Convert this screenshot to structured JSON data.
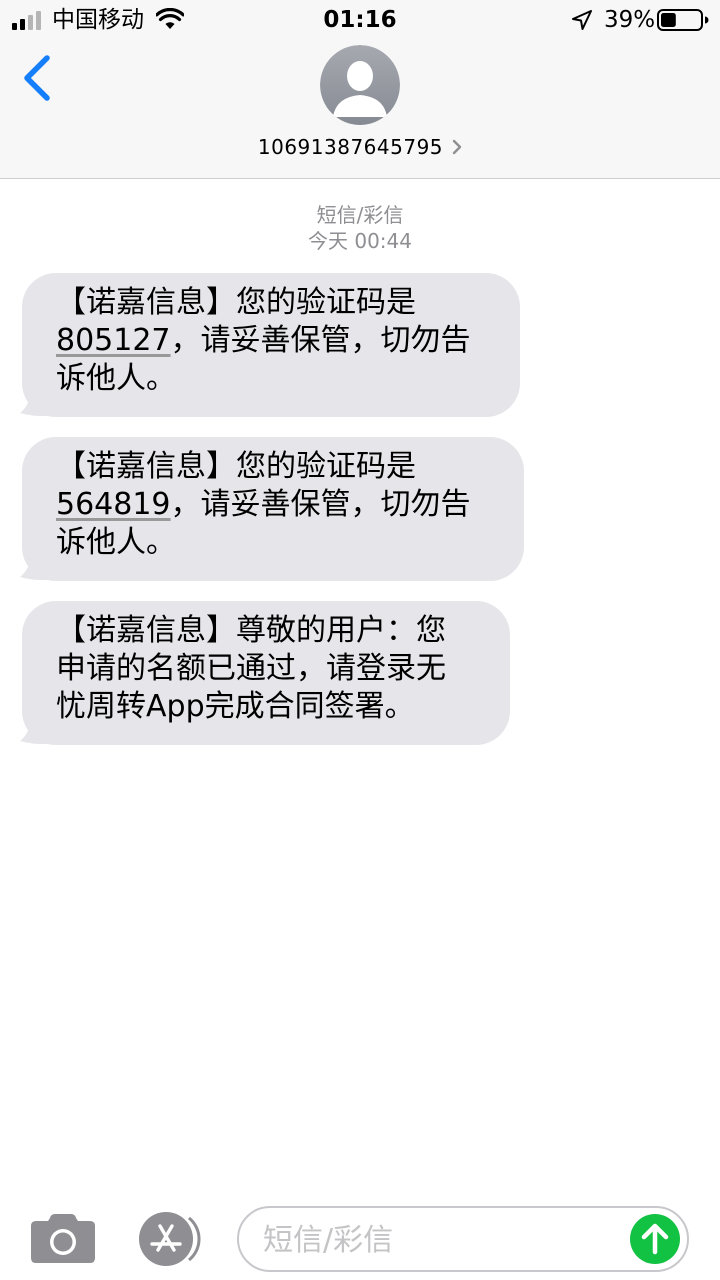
{
  "status_bar": {
    "carrier": "中国移动",
    "time": "01:16",
    "battery_percent": "39%",
    "battery_level": 0.39,
    "icons": [
      "signal-icon",
      "wifi-icon",
      "location-arrow-icon",
      "battery-icon"
    ]
  },
  "header": {
    "back_icon": "chevron-left-icon",
    "avatar_icon": "person-silhouette-icon",
    "contact_number": "10691387645795",
    "contact_chevron_icon": "chevron-right-icon"
  },
  "conversation": {
    "service_label": "短信/彩信",
    "timestamp": "今天 00:44",
    "messages": [
      {
        "lines": [
          "【诺嘉信息】您的验证码是",
          "，请妥善保管，切勿告",
          "诉他人。"
        ],
        "code": "805127"
      },
      {
        "lines": [
          "【诺嘉信息】您的验证码是",
          "，请妥善保管，切勿告",
          "诉他人。"
        ],
        "code": "564819"
      },
      {
        "lines": [
          "【诺嘉信息】尊敬的用户：您",
          "申请的名额已通过，请登录无",
          "忧周转App完成合同签署。"
        ]
      }
    ]
  },
  "input_bar": {
    "camera_icon": "camera-icon",
    "apps_icon": "app-store-icon",
    "placeholder": "短信/彩信",
    "value": "",
    "send_icon": "arrow-up-icon"
  },
  "colors": {
    "accent": "#147efb",
    "bubble_received": "#e5e5ea",
    "send_button": "#12c242",
    "meta_text": "#8e8e93"
  }
}
